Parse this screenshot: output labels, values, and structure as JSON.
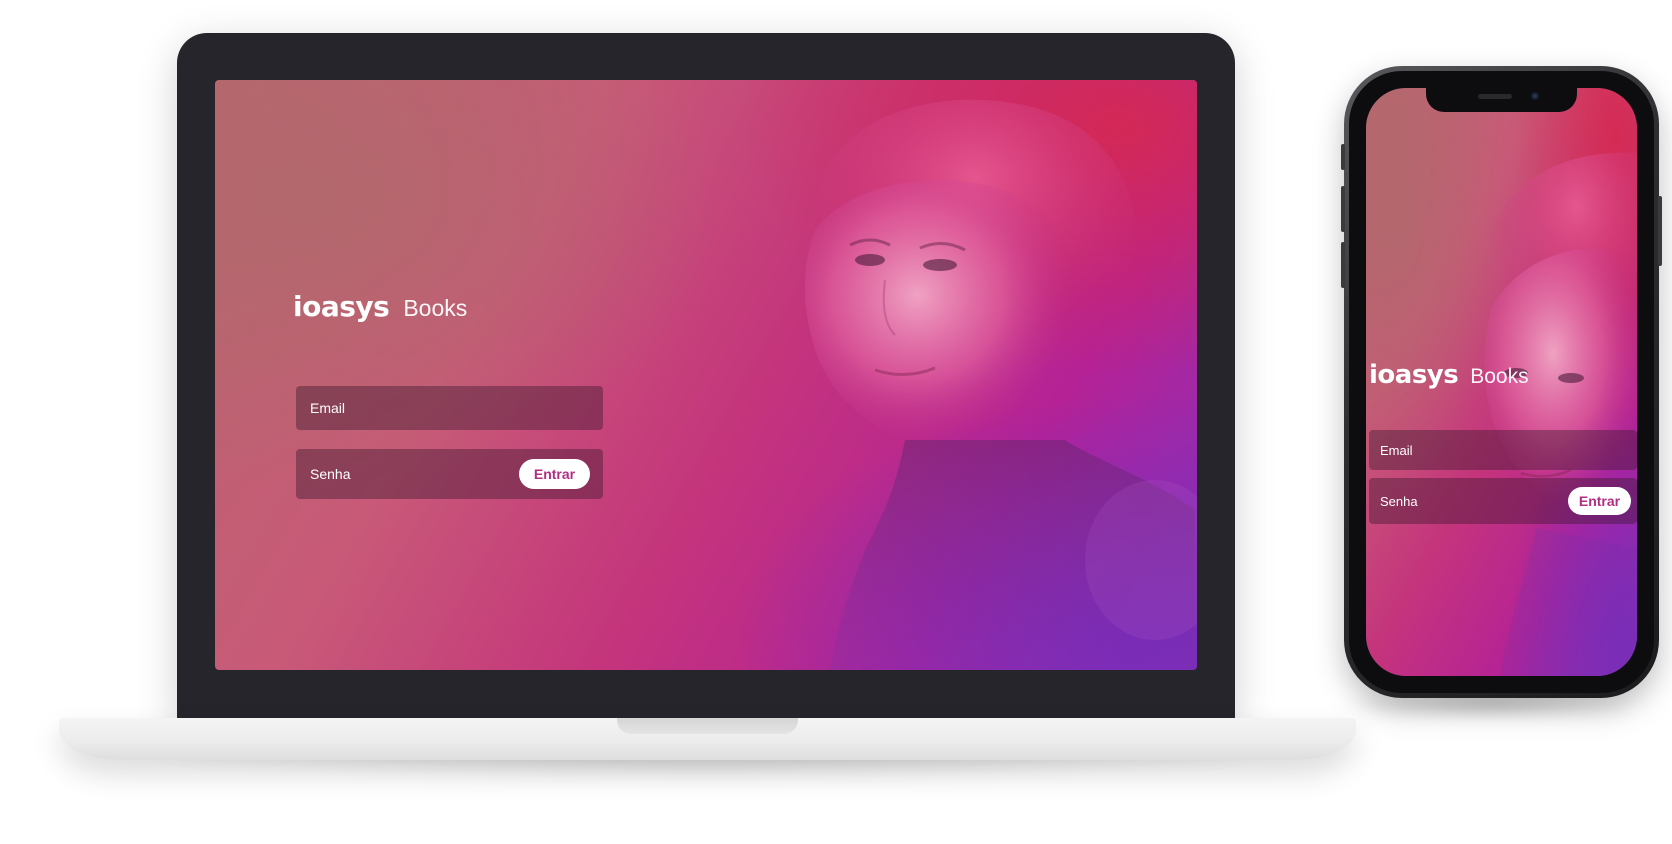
{
  "app": {
    "brand_logo": "ioasys",
    "brand_title": "Books"
  },
  "login": {
    "email_label": "Email",
    "password_label": "Senha",
    "submit_label": "Entrar"
  },
  "colors": {
    "accent": "#b22e83",
    "gradient_start": "#b8666e",
    "gradient_mid": "#c4347c",
    "gradient_end": "#8a30b8",
    "device_frame": "#26252c",
    "button_bg": "#ffffff"
  },
  "devices": [
    "laptop",
    "phone"
  ]
}
